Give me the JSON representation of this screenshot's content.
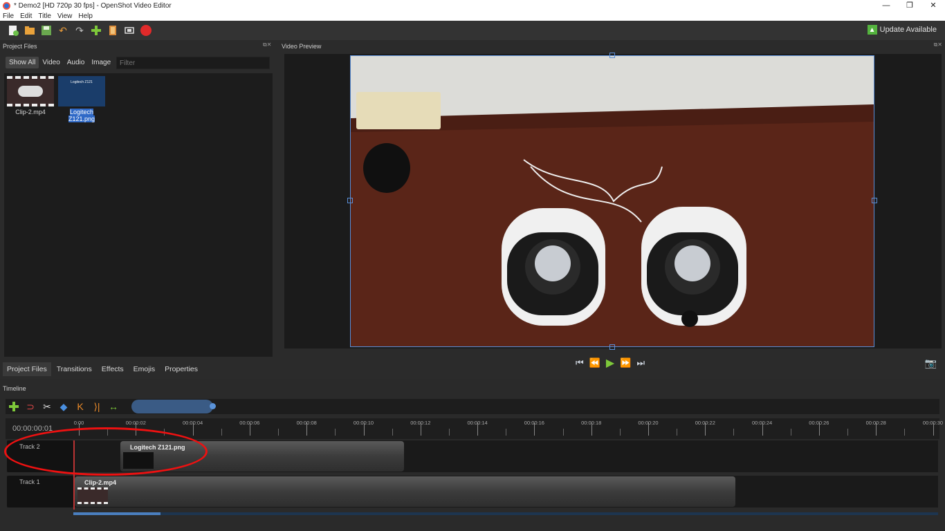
{
  "window": {
    "title": "* Demo2 [HD 720p 30 fps] - OpenShot Video Editor",
    "minimize": "—",
    "maximize": "❐",
    "close": "✕"
  },
  "menu": [
    "File",
    "Edit",
    "Title",
    "View",
    "Help"
  ],
  "toolbar": {
    "update_label": "Update Available"
  },
  "project_files": {
    "panel_title": "Project Files",
    "filters": [
      "Show All",
      "Video",
      "Audio",
      "Image"
    ],
    "filter_placeholder": "Filter",
    "files": [
      {
        "name": "Clip-2.mp4"
      },
      {
        "name": "Logitech Z121.png",
        "thumb_text": "Logitech Z121"
      }
    ]
  },
  "bottom_tabs": [
    "Project Files",
    "Transitions",
    "Effects",
    "Emojis",
    "Properties"
  ],
  "video_preview": {
    "panel_title": "Video Preview"
  },
  "timeline": {
    "panel_title": "Timeline",
    "time_display": "00:00:00:01",
    "ticks": [
      "0:00",
      "00:00:02",
      "00:00:04",
      "00:00:06",
      "00:00:08",
      "00:00:10",
      "00:00:12",
      "00:00:14",
      "00:00:16",
      "00:00:18",
      "00:00:20",
      "00:00:22",
      "00:00:24",
      "00:00:26",
      "00:00:28",
      "00:00:30"
    ],
    "tracks": [
      {
        "name": "Track 2",
        "clip": "Logitech Z121.png"
      },
      {
        "name": "Track 1",
        "clip": "Clip-2.mp4"
      }
    ]
  },
  "colors": {
    "accent": "#2f69c7",
    "annotation": "#e11111",
    "play": "#7ec83a"
  }
}
